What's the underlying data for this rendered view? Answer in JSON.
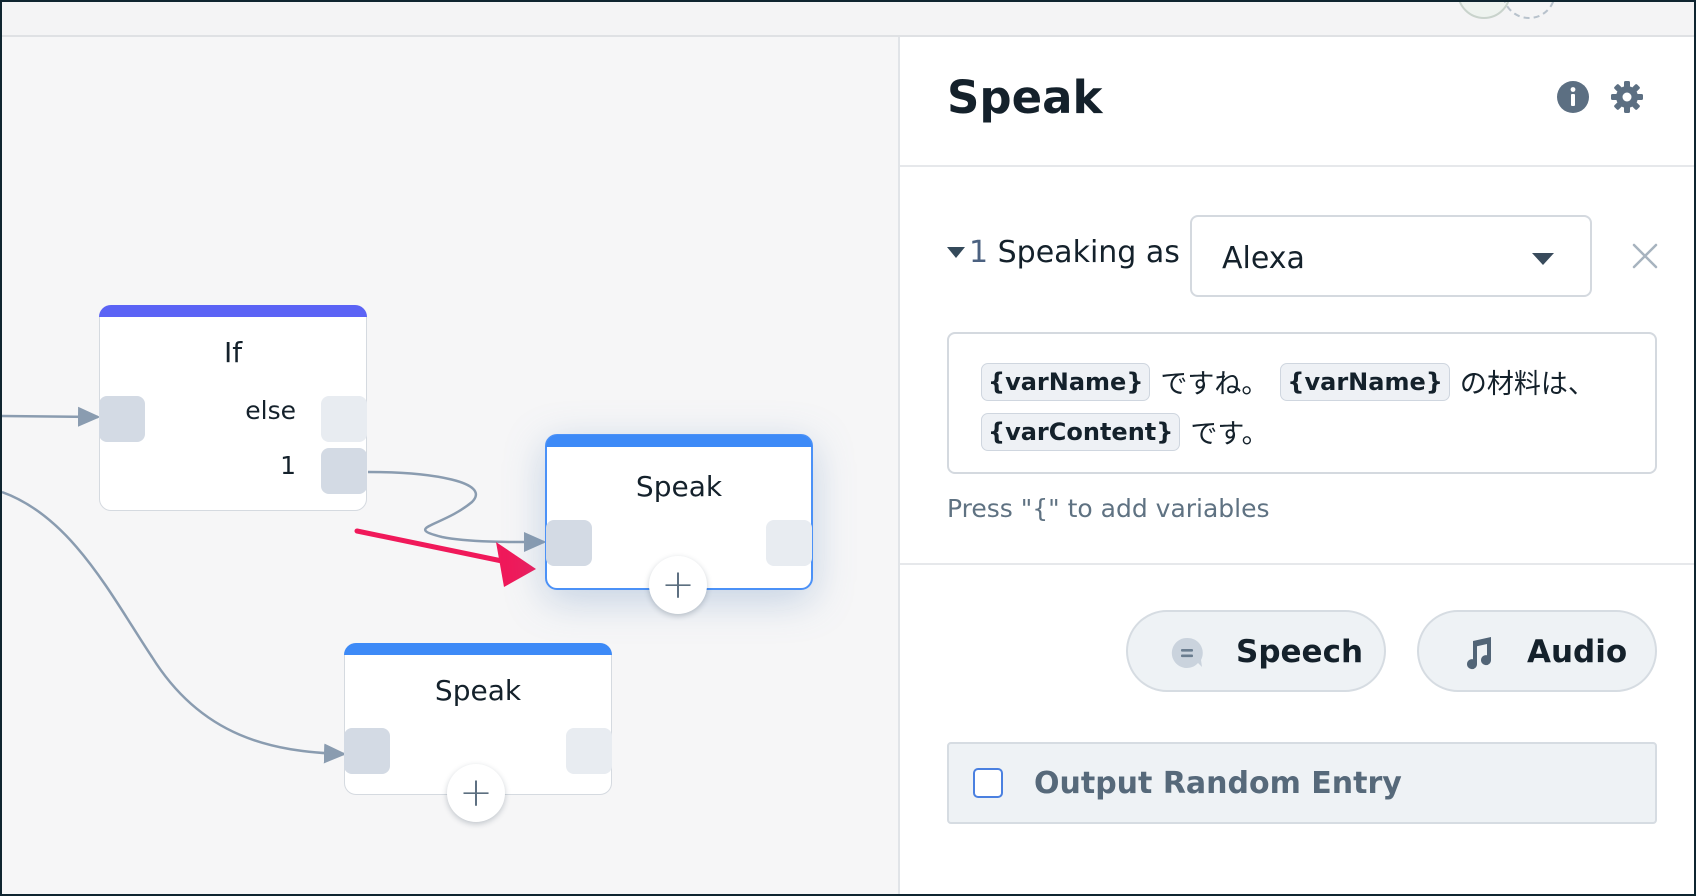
{
  "canvas": {
    "if_block": {
      "title": "If",
      "branches": [
        "else",
        "1"
      ],
      "accent": "#5b63f5"
    },
    "speak_block_selected": {
      "title": "Speak",
      "accent": "#3d8af7",
      "add_icon": "plus-icon"
    },
    "speak_block_lower": {
      "title": "Speak",
      "accent": "#3d8af7",
      "add_icon": "plus-icon"
    },
    "annotation_arrow_color": "#f0195a"
  },
  "panel": {
    "title": "Speak",
    "header_icons": [
      "info-icon",
      "gear-icon"
    ],
    "voice": {
      "index": "1",
      "label": "Speaking as",
      "selected": "Alexa"
    },
    "speech": {
      "line1": [
        {
          "type": "var",
          "text": "{varName}"
        },
        {
          "type": "text",
          "text": "ですね。"
        },
        {
          "type": "var",
          "text": "{varName}"
        },
        {
          "type": "text",
          "text": "の材料は、"
        }
      ],
      "line2": [
        {
          "type": "var",
          "text": "{varContent}"
        },
        {
          "type": "text",
          "text": "です。"
        }
      ]
    },
    "hint": "Press \"{\" to add variables",
    "buttons": {
      "speech": "Speech",
      "audio": "Audio"
    },
    "random_entry": {
      "label": "Output Random Entry",
      "checked": false
    }
  },
  "colors": {
    "checkbox_border": "#4a80e0",
    "port": "#d3dae4",
    "connector": "#8a9cb0"
  }
}
